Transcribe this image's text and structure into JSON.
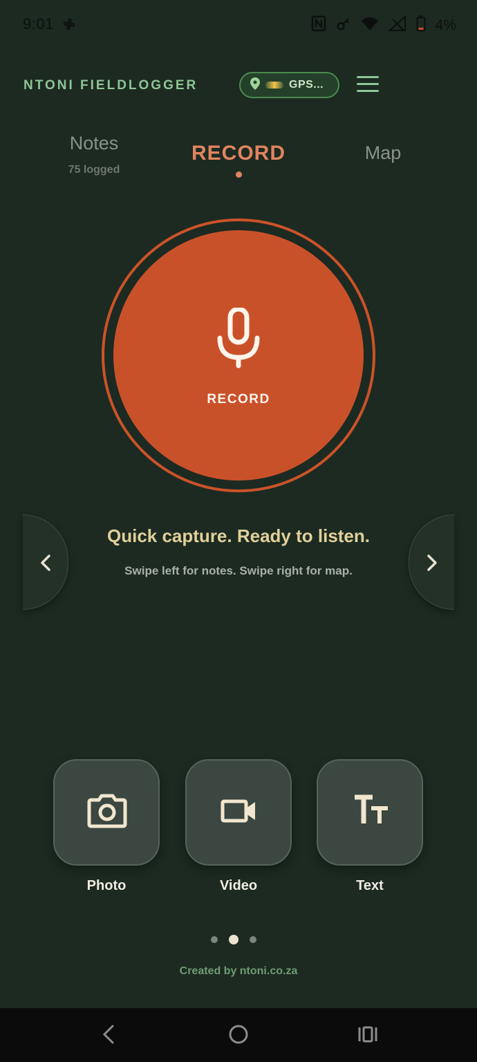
{
  "status_bar": {
    "time": "9:01",
    "battery": "4%",
    "icons": [
      "fan-icon",
      "nfc-icon",
      "key-icon",
      "wifi-icon",
      "signal-icon",
      "battery-icon"
    ]
  },
  "header": {
    "title": "NTONI FIELDLOGGER",
    "gps_label": "GPS..."
  },
  "tabs": [
    {
      "label": "Notes",
      "sub": "75 logged"
    },
    {
      "label": "RECORD"
    },
    {
      "label": "Map"
    }
  ],
  "record": {
    "label": "RECORD"
  },
  "capture": {
    "headline": "Quick capture. Ready to listen.",
    "subline": "Swipe left for notes. Swipe right for map."
  },
  "quick_actions": [
    {
      "label": "Photo",
      "icon": "camera-icon"
    },
    {
      "label": "Video",
      "icon": "video-camera-icon"
    },
    {
      "label": "Text",
      "icon": "text-icon"
    }
  ],
  "pagination": {
    "count": 3,
    "active": 2
  },
  "footer": {
    "credit": "Created by ntoni.co.za"
  },
  "colors": {
    "background": "#1c2a21",
    "accent": "#c9512a",
    "title_green": "#8fc596",
    "headline_yellow": "#e0d09a"
  }
}
